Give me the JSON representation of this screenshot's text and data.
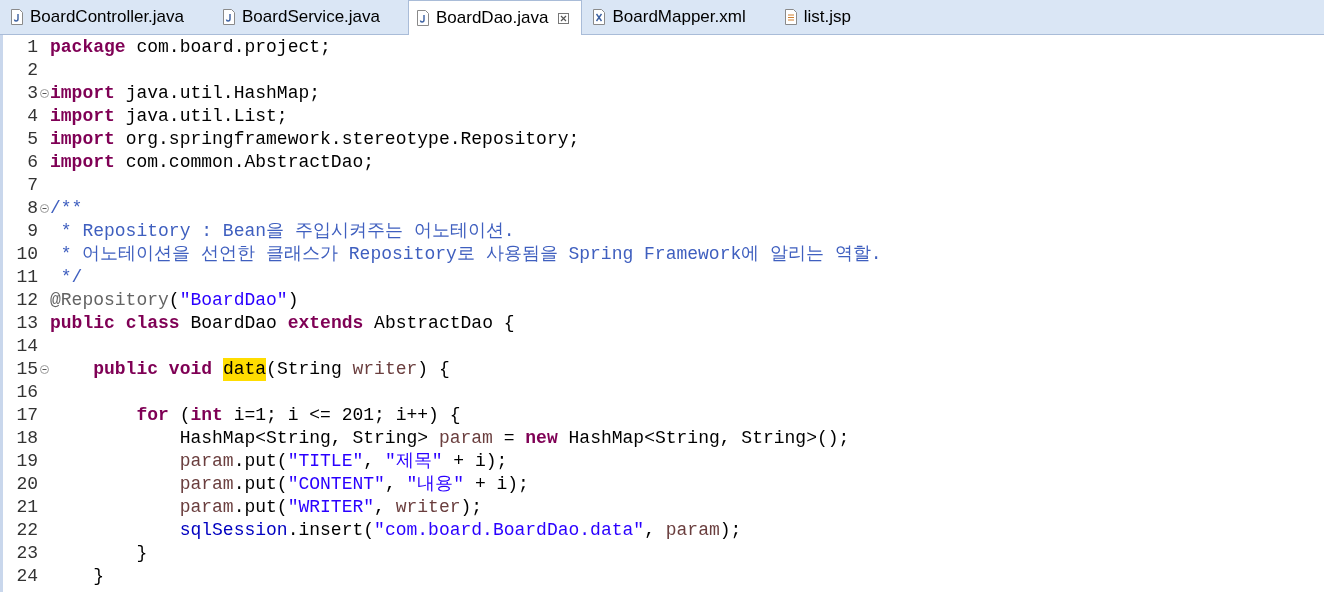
{
  "tabs": [
    {
      "label": "BoardController.java",
      "kind": "java",
      "selected": false
    },
    {
      "label": "BoardService.java",
      "kind": "java",
      "selected": false
    },
    {
      "label": "BoardDao.java",
      "kind": "java",
      "selected": true
    },
    {
      "label": "BoardMapper.xml",
      "kind": "xml",
      "selected": false
    },
    {
      "label": "list.jsp",
      "kind": "jsp",
      "selected": false
    }
  ],
  "editor": {
    "lines": [
      {
        "number": "1",
        "folding": false,
        "tokens": [
          {
            "kind": "keyword",
            "text": "package"
          },
          {
            "kind": "plain",
            "text": " com.board.project;"
          }
        ]
      },
      {
        "number": "2",
        "folding": false
      },
      {
        "number": "3",
        "folding": true,
        "tokens": [
          {
            "kind": "keyword",
            "text": "import"
          },
          {
            "kind": "plain",
            "text": " java.util.HashMap;"
          }
        ]
      },
      {
        "number": "4",
        "folding": false,
        "tokens": [
          {
            "kind": "keyword",
            "text": "import"
          },
          {
            "kind": "plain",
            "text": " java.util.List;"
          }
        ]
      },
      {
        "number": "5",
        "folding": false,
        "tokens": [
          {
            "kind": "keyword",
            "text": "import"
          },
          {
            "kind": "plain",
            "text": " org.springframework.stereotype.Repository;"
          }
        ]
      },
      {
        "number": "6",
        "folding": false,
        "tokens": [
          {
            "kind": "keyword",
            "text": "import"
          },
          {
            "kind": "plain",
            "text": " com.common.AbstractDao;"
          }
        ]
      },
      {
        "number": "7",
        "folding": false
      },
      {
        "number": "8",
        "folding": true,
        "tokens": [
          {
            "kind": "comment",
            "text": "/**"
          }
        ]
      },
      {
        "number": "9",
        "folding": false,
        "tokens": [
          {
            "kind": "comment",
            "text": " * Repository : Bean을 주입시켜주는 어노테이션."
          }
        ]
      },
      {
        "number": "10",
        "folding": false,
        "tokens": [
          {
            "kind": "comment",
            "text": " * 어노테이션을 선언한 클래스가 Repository로 사용됨을 Spring Framework에 알리는 역할."
          }
        ]
      },
      {
        "number": "11",
        "folding": false,
        "tokens": [
          {
            "kind": "comment",
            "text": " */"
          }
        ]
      },
      {
        "number": "12",
        "folding": false,
        "tokens": [
          {
            "kind": "annotation",
            "text": "@Repository"
          },
          {
            "kind": "plain",
            "text": "("
          },
          {
            "kind": "string",
            "text": "\"BoardDao\""
          },
          {
            "kind": "plain",
            "text": ")"
          }
        ]
      },
      {
        "number": "13",
        "folding": false,
        "tokens": [
          {
            "kind": "keyword",
            "text": "public"
          },
          {
            "kind": "keyword",
            "text": " class"
          },
          {
            "kind": "plain",
            "text": " BoardDao "
          },
          {
            "kind": "keyword",
            "text": "extends"
          },
          {
            "kind": "plain",
            "text": " AbstractDao {"
          }
        ]
      },
      {
        "number": "14",
        "folding": false
      },
      {
        "number": "15",
        "folding": true,
        "tokens": [
          {
            "kind": "keyword",
            "text": "    public"
          },
          {
            "kind": "keyword",
            "text": " void"
          },
          {
            "kind": "highlight",
            "text": " data"
          },
          {
            "kind": "plain",
            "text": "(String "
          },
          {
            "kind": "variable",
            "text": "writer"
          },
          {
            "kind": "plain",
            "text": ") {"
          }
        ]
      },
      {
        "number": "16",
        "folding": false
      },
      {
        "number": "17",
        "folding": false,
        "tokens": [
          {
            "kind": "keyword",
            "text": "        for"
          },
          {
            "kind": "plain",
            "text": " ("
          },
          {
            "kind": "keyword",
            "text": "int"
          },
          {
            "kind": "plain",
            "text": " i=1; i <= 201; i++) {"
          }
        ]
      },
      {
        "number": "18",
        "folding": false,
        "tokens": [
          {
            "kind": "plain",
            "text": "            HashMap<String, String> "
          },
          {
            "kind": "variable",
            "text": "param"
          },
          {
            "kind": "plain",
            "text": " = "
          },
          {
            "kind": "keyword",
            "text": "new"
          },
          {
            "kind": "plain",
            "text": " HashMap<String, String>();"
          }
        ]
      },
      {
        "number": "19",
        "folding": false,
        "tokens": [
          {
            "kind": "variable",
            "text": "            param"
          },
          {
            "kind": "plain",
            "text": ".put("
          },
          {
            "kind": "string",
            "text": "\"TITLE\""
          },
          {
            "kind": "plain",
            "text": ", "
          },
          {
            "kind": "string",
            "text": "\"제목\""
          },
          {
            "kind": "plain",
            "text": " + i);"
          }
        ]
      },
      {
        "number": "20",
        "folding": false,
        "tokens": [
          {
            "kind": "variable",
            "text": "            param"
          },
          {
            "kind": "plain",
            "text": ".put("
          },
          {
            "kind": "string",
            "text": "\"CONTENT\""
          },
          {
            "kind": "plain",
            "text": ", "
          },
          {
            "kind": "string",
            "text": "\"내용\""
          },
          {
            "kind": "plain",
            "text": " + i);"
          }
        ]
      },
      {
        "number": "21",
        "folding": false,
        "tokens": [
          {
            "kind": "variable",
            "text": "            param"
          },
          {
            "kind": "plain",
            "text": ".put("
          },
          {
            "kind": "string",
            "text": "\"WRITER\""
          },
          {
            "kind": "plain",
            "text": ", "
          },
          {
            "kind": "variable",
            "text": "writer"
          },
          {
            "kind": "plain",
            "text": ");"
          }
        ]
      },
      {
        "number": "22",
        "folding": false,
        "tokens": [
          {
            "kind": "field",
            "text": "            sqlSession"
          },
          {
            "kind": "plain",
            "text": ".insert("
          },
          {
            "kind": "string",
            "text": "\"com.board.BoardDao.data\""
          },
          {
            "kind": "plain",
            "text": ", "
          },
          {
            "kind": "variable",
            "text": "param"
          },
          {
            "kind": "plain",
            "text": ");"
          }
        ]
      },
      {
        "number": "23",
        "folding": false,
        "tokens": [
          {
            "kind": "plain",
            "text": "        }"
          }
        ]
      },
      {
        "number": "24",
        "folding": false,
        "tokens": [
          {
            "kind": "plain",
            "text": "    }"
          }
        ]
      }
    ]
  }
}
